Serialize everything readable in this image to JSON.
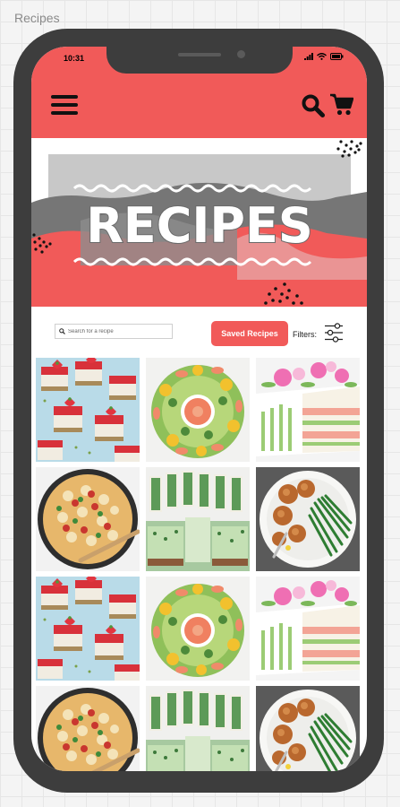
{
  "frame": {
    "label": "Recipes"
  },
  "status_bar": {
    "time": "10:31"
  },
  "header": {
    "menu_icon": "hamburger-menu-icon",
    "search_icon": "search-icon",
    "cart_icon": "cart-icon"
  },
  "hero": {
    "title": "RECIPES"
  },
  "controls": {
    "search_placeholder": "Search for a recipe",
    "saved_button_label": "Saved Recipes",
    "filters_label": "Filters:",
    "filter_icon": "sliders-icon"
  },
  "colors": {
    "brand_red": "#f15a59",
    "phone_body": "#3d3d3d",
    "hero_gray": "#c8c8c8"
  },
  "recipes": [
    {
      "image": "strawberry-cheesecake-squares"
    },
    {
      "image": "prawn-avocado-salad-wreath"
    },
    {
      "image": "layered-sandwich-cake"
    },
    {
      "image": "pasta-bake-skillet"
    },
    {
      "image": "pea-mint-sandwich-slices"
    },
    {
      "image": "fishcakes-with-green-beans"
    },
    {
      "image": "strawberry-cheesecake-squares"
    },
    {
      "image": "prawn-avocado-salad-wreath"
    },
    {
      "image": "layered-sandwich-cake"
    },
    {
      "image": "pasta-bake-skillet"
    },
    {
      "image": "pea-mint-sandwich-slices"
    },
    {
      "image": "fishcakes-with-green-beans"
    }
  ]
}
